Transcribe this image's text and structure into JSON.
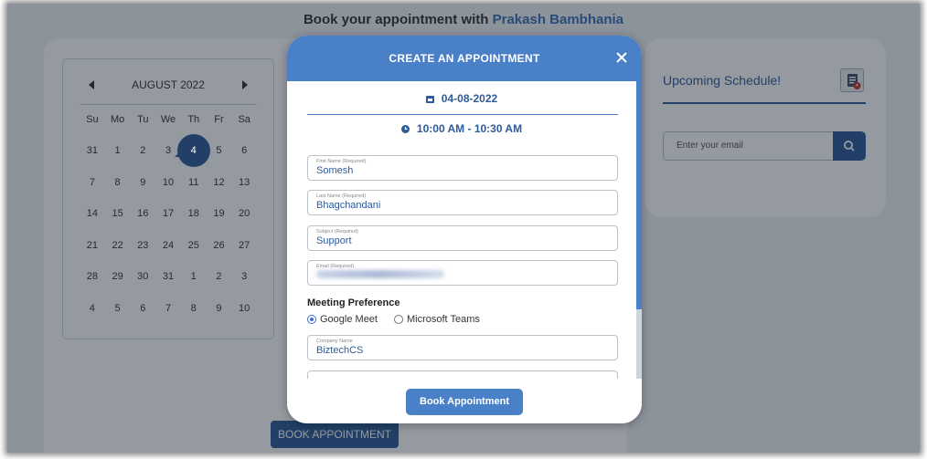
{
  "page": {
    "title_prefix": "Book your appointment with",
    "host_name": "Prakash Bambhania"
  },
  "calendar": {
    "month_label": "AUGUST 2022",
    "days_of_week": [
      "Su",
      "Mo",
      "Tu",
      "We",
      "Th",
      "Fr",
      "Sa"
    ],
    "weeks": [
      [
        "31",
        "1",
        "2",
        "3",
        "4",
        "5",
        "6"
      ],
      [
        "7",
        "8",
        "9",
        "10",
        "11",
        "12",
        "13"
      ],
      [
        "14",
        "15",
        "16",
        "17",
        "18",
        "19",
        "20"
      ],
      [
        "21",
        "22",
        "23",
        "24",
        "25",
        "26",
        "27"
      ],
      [
        "28",
        "29",
        "30",
        "31",
        "1",
        "2",
        "3"
      ],
      [
        "4",
        "5",
        "6",
        "7",
        "8",
        "9",
        "10"
      ]
    ],
    "selected_day": "4",
    "book_label": "BOOK APPOINTMENT"
  },
  "upcoming": {
    "title": "Upcoming Schedule!",
    "email_placeholder": "Enter your email"
  },
  "modal": {
    "title": "CREATE AN APPOINTMENT",
    "date": "04-08-2022",
    "time": "10:00 AM - 10:30 AM",
    "fields": {
      "first_name": {
        "label": "First Name (Required)",
        "value": "Somesh"
      },
      "last_name": {
        "label": "Last Name (Required)",
        "value": "Bhagchandani"
      },
      "subject": {
        "label": "Subject (Required)",
        "value": "Support"
      },
      "email": {
        "label": "Email (Required)",
        "value": ""
      },
      "company": {
        "label": "Company Name",
        "value": "BiztechCS"
      }
    },
    "meeting_preference": {
      "title": "Meeting Preference",
      "options": [
        "Google Meet",
        "Microsoft Teams"
      ],
      "selected": "Google Meet"
    },
    "book_button": "Book Appointment"
  },
  "colors": {
    "accent": "#4a80c8",
    "dark_accent": "#2e5b97"
  },
  "icons": {
    "calendar_prev": "triangle-left-icon",
    "calendar_next": "triangle-right-icon",
    "close": "close-icon",
    "date": "calendar-icon",
    "time": "clock-icon",
    "search": "search-icon",
    "schedule": "schedule-icon"
  }
}
